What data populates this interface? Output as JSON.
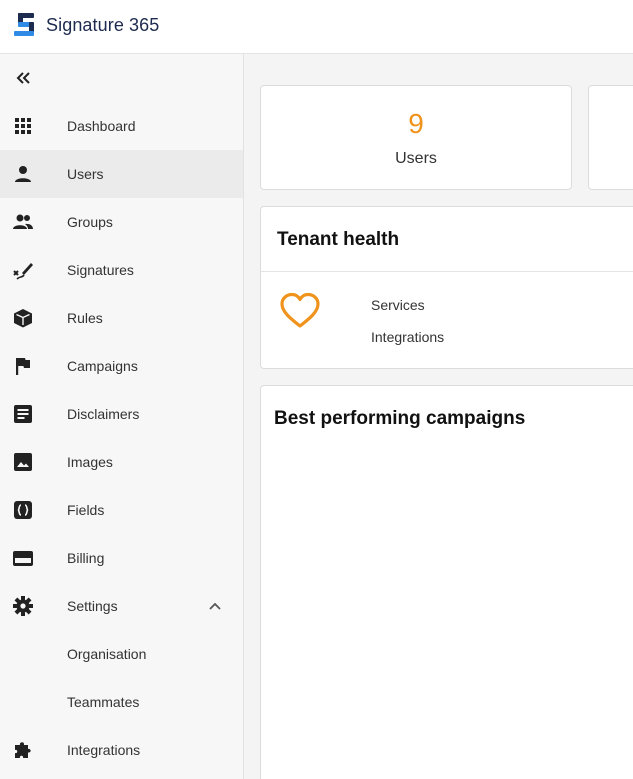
{
  "app": {
    "name": "Signature 365"
  },
  "sidebar": {
    "items": [
      {
        "label": "Dashboard",
        "icon": "grid-icon",
        "active": false
      },
      {
        "label": "Users",
        "icon": "person-icon",
        "active": true
      },
      {
        "label": "Groups",
        "icon": "people-icon",
        "active": false
      },
      {
        "label": "Signatures",
        "icon": "signature-icon",
        "active": false
      },
      {
        "label": "Rules",
        "icon": "cube-icon",
        "active": false
      },
      {
        "label": "Campaigns",
        "icon": "flag-icon",
        "active": false
      },
      {
        "label": "Disclaimers",
        "icon": "document-icon",
        "active": false
      },
      {
        "label": "Images",
        "icon": "image-icon",
        "active": false
      },
      {
        "label": "Fields",
        "icon": "braces-icon",
        "active": false
      },
      {
        "label": "Billing",
        "icon": "credit-card-icon",
        "active": false
      },
      {
        "label": "Settings",
        "icon": "gear-icon",
        "active": false,
        "expanded": true
      },
      {
        "label": "Organisation",
        "icon": null,
        "active": false
      },
      {
        "label": "Teammates",
        "icon": null,
        "active": false
      },
      {
        "label": "Integrations",
        "icon": "puzzle-icon",
        "active": false
      }
    ]
  },
  "main": {
    "stats": [
      {
        "value": "9",
        "label": "Users"
      }
    ],
    "tenant_health": {
      "title": "Tenant health",
      "rows": [
        "Services",
        "Integrations"
      ]
    },
    "campaigns": {
      "title": "Best performing campaigns"
    }
  },
  "colors": {
    "accent": "#f0931d",
    "brand_dark": "#1d2b4f",
    "brand_blue": "#2f8be6"
  }
}
